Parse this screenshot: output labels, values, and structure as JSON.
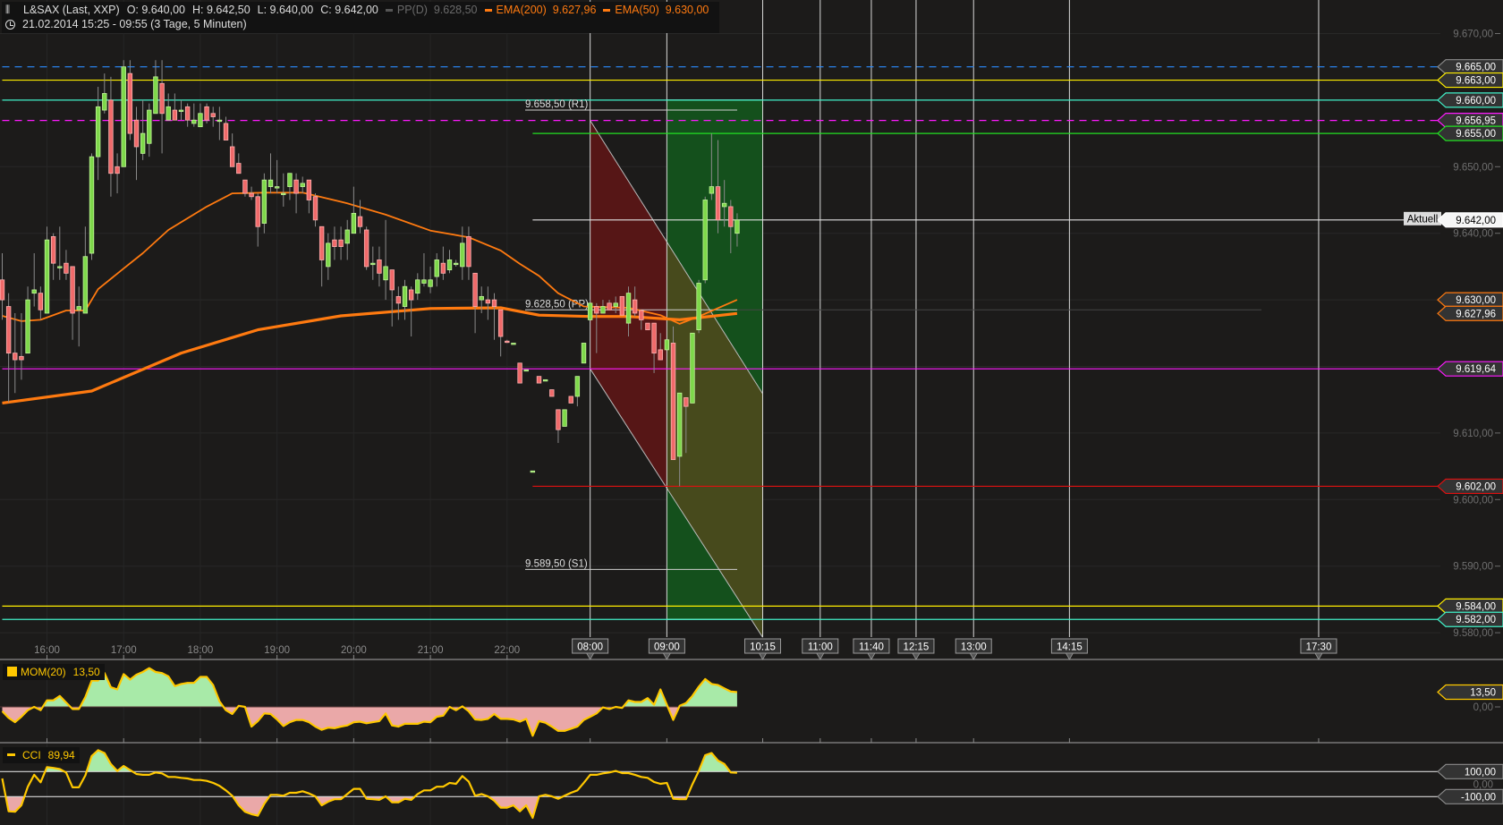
{
  "header": {
    "symbol": "L&SAX (Last, XXP)",
    "open": "O: 9.640,00",
    "high": "H: 9.642,50",
    "low": "L: 9.640,00",
    "close": "C: 9.642,00",
    "pp_label": "PP(D)",
    "pp_value": "9.628,50",
    "ema200_label": "EMA(200)",
    "ema200_value": "9.627,96",
    "ema50_label": "EMA(50)",
    "ema50_value": "9.630,00",
    "range": "21.02.2014 15:25 - 09:55 (3 Tage, 5 Minuten)",
    "icons": [
      "candlestick-chart-icon",
      "clock-icon"
    ]
  },
  "colors": {
    "background": "#1c1b1a",
    "up_candle": "#7ed84a",
    "down_candle": "#f06a6a",
    "ema": "#ff7a10",
    "indicator_line": "#ffc800",
    "positive_fill": "#a8eaa8",
    "negative_fill": "#eaa8a8"
  },
  "chart_data": {
    "type": "candlestick",
    "title": "L&SAX (Last, XXP)",
    "interval": "5 Minuten",
    "ylim": [
      9578,
      9672
    ],
    "y_ticks": [
      "9.670,00",
      "9.650,00",
      "9.640,00",
      "9.610,00",
      "9.600,00",
      "9.590,00",
      "9.580,00"
    ],
    "y_tick_values": [
      9670,
      9650,
      9640,
      9610,
      9600,
      9590,
      9580
    ],
    "grid": true,
    "x_labels": [
      {
        "i": 7,
        "label": "16:00"
      },
      {
        "i": 19,
        "label": "17:00"
      },
      {
        "i": 31,
        "label": "18:00"
      },
      {
        "i": 43,
        "label": "19:00"
      },
      {
        "i": 55,
        "label": "20:00"
      },
      {
        "i": 67,
        "label": "21:00"
      },
      {
        "i": 79,
        "label": "22:00"
      }
    ],
    "time_markers": [
      {
        "i": 92,
        "label": "08:00"
      },
      {
        "i": 104,
        "label": "09:00"
      },
      {
        "i": 119,
        "label": "10:15"
      },
      {
        "i": 128,
        "label": "11:00"
      },
      {
        "i": 136,
        "label": "11:40"
      },
      {
        "i": 143,
        "label": "12:15"
      },
      {
        "i": 152,
        "label": "13:00"
      },
      {
        "i": 167,
        "label": "14:15"
      },
      {
        "i": 206,
        "label": "17:30"
      }
    ],
    "candles": [
      [
        9633,
        9637,
        9627,
        9630
      ],
      [
        9629,
        9631,
        9614.6,
        9622
      ],
      [
        9622,
        9628,
        9616,
        9621
      ],
      [
        9621.5,
        9628,
        9618,
        9621
      ],
      [
        9622,
        9632,
        9622,
        9630
      ],
      [
        9631,
        9637,
        9629,
        9631.5
      ],
      [
        9631,
        9632,
        9627,
        9628.5
      ],
      [
        9628,
        9641,
        9628,
        9639
      ],
      [
        9639.5,
        9640,
        9633,
        9635.5
      ],
      [
        9635,
        9641,
        9633,
        9635
      ],
      [
        9635.5,
        9637.5,
        9633,
        9634
      ],
      [
        9635,
        9635,
        9624,
        9628
      ],
      [
        9628.5,
        9632,
        9623,
        9629
      ],
      [
        9628,
        9641,
        9628,
        9636.5
      ],
      [
        9637,
        9652,
        9636,
        9651.5
      ],
      [
        9651.5,
        9662,
        9648,
        9659
      ],
      [
        9658.5,
        9664,
        9658,
        9661
      ],
      [
        9660,
        9663.5,
        9645.5,
        9649
      ],
      [
        9650,
        9652,
        9646,
        9649
      ],
      [
        9650,
        9666,
        9650,
        9665
      ],
      [
        9664,
        9666,
        9654,
        9655
      ],
      [
        9657,
        9659,
        9648,
        9653
      ],
      [
        9652,
        9660,
        9651,
        9655
      ],
      [
        9653.5,
        9659.5,
        9651.5,
        9658.5
      ],
      [
        9658,
        9666,
        9658,
        9663.5
      ],
      [
        9662.5,
        9666,
        9652,
        9658
      ],
      [
        9657,
        9661,
        9657,
        9659
      ],
      [
        9658.5,
        9661,
        9657,
        9657
      ],
      [
        9658.5,
        9660,
        9657,
        9658.5
      ],
      [
        9659,
        9659.5,
        9656,
        9657
      ],
      [
        9656.5,
        9659.5,
        9656,
        9657
      ],
      [
        9656,
        9659.5,
        9656,
        9658
      ],
      [
        9659,
        9659.5,
        9656.5,
        9657
      ],
      [
        9658,
        9659,
        9656,
        9657.5
      ],
      [
        9657,
        9659,
        9654,
        9657
      ],
      [
        9656.5,
        9657.5,
        9654,
        9654
      ],
      [
        9653,
        9655,
        9650,
        9650
      ],
      [
        9650.5,
        9652,
        9649,
        9649
      ],
      [
        9648,
        9648,
        9645.5,
        9646
      ],
      [
        9646,
        9647,
        9645,
        9645.5
      ],
      [
        9645.5,
        9646,
        9638,
        9641
      ],
      [
        9641.5,
        9649,
        9640,
        9648
      ],
      [
        9647,
        9652,
        9646,
        9648
      ],
      [
        9647,
        9651,
        9646,
        9647
      ],
      [
        9646,
        9649,
        9644,
        9646
      ],
      [
        9647,
        9649,
        9645,
        9649
      ],
      [
        9648,
        9649,
        9643,
        9646
      ],
      [
        9647,
        9648.5,
        9646,
        9647.5
      ],
      [
        9648,
        9648,
        9643,
        9645
      ],
      [
        9645.5,
        9646,
        9641,
        9642
      ],
      [
        9641,
        9641,
        9632,
        9636
      ],
      [
        9635,
        9640,
        9633,
        9638.5
      ],
      [
        9639,
        9641,
        9636,
        9638
      ],
      [
        9639,
        9641,
        9636,
        9638
      ],
      [
        9638.5,
        9642,
        9636,
        9640.5
      ],
      [
        9640,
        9647,
        9640,
        9643
      ],
      [
        9642.5,
        9645,
        9640,
        9641
      ],
      [
        9640.5,
        9641,
        9634.5,
        9635
      ],
      [
        9635.5,
        9638,
        9633,
        9635.5
      ],
      [
        9636,
        9638,
        9632,
        9634
      ],
      [
        9633,
        9642,
        9630,
        9635
      ],
      [
        9634.5,
        9634.5,
        9626,
        9631.5
      ],
      [
        9630.5,
        9632,
        9627,
        9629.5
      ],
      [
        9629,
        9633,
        9627,
        9632
      ],
      [
        9631.5,
        9632,
        9624.5,
        9630
      ],
      [
        9631,
        9634,
        9630,
        9633
      ],
      [
        9632.5,
        9637,
        9632,
        9633
      ],
      [
        9632,
        9635,
        9631,
        9633
      ],
      [
        9633.5,
        9637,
        9632,
        9636
      ],
      [
        9635.5,
        9638,
        9633,
        9634
      ],
      [
        9634.5,
        9637.5,
        9634,
        9636
      ],
      [
        9635.5,
        9636,
        9635,
        9635.5
      ],
      [
        9635,
        9641,
        9633,
        9638.5
      ],
      [
        9639.5,
        9641,
        9633,
        9635
      ],
      [
        9634,
        9634,
        9625,
        9629
      ],
      [
        9630,
        9632,
        9628,
        9630.5
      ],
      [
        9630,
        9632,
        9627,
        9629.5
      ],
      [
        9630,
        9631,
        9624,
        9629
      ],
      [
        9628.5,
        9628.5,
        9621.5,
        9624.5
      ],
      [
        9623.8,
        9624,
        9623.5,
        9623.7
      ],
      [
        9623.5,
        9623.5,
        9623.5,
        9623.5
      ],
      [
        9620.5,
        9620.5,
        9617.5,
        9617.5
      ],
      [
        9619.5,
        9619.5,
        9619.5,
        9619.5
      ],
      [
        9604.3,
        9604.3,
        9604.3,
        9604.3
      ],
      [
        9618.5,
        9618.5,
        9617.5,
        9617.5
      ],
      [
        9618,
        9618,
        9618,
        9618
      ],
      [
        9616.5,
        9616.5,
        9615.5,
        9615.5
      ],
      [
        9613.5,
        9613.5,
        9608.5,
        9610.5
      ],
      [
        9611,
        9613.5,
        9611,
        9613.5
      ],
      [
        9615.5,
        9615.5,
        9614.5,
        9614.5
      ],
      [
        9615.5,
        9618.5,
        9614,
        9618.5
      ],
      [
        9620.5,
        9623.5,
        9620.5,
        9623.5
      ],
      [
        9627,
        9630,
        9627,
        9629.5
      ],
      [
        9629,
        9629.5,
        9622,
        9628
      ],
      [
        9628,
        9630,
        9628,
        9629
      ],
      [
        9629.5,
        9630,
        9628.5,
        9628.5
      ],
      [
        9629,
        9630.5,
        9628,
        9629.5
      ],
      [
        9630.5,
        9630.5,
        9627.7,
        9627.7
      ],
      [
        9626.5,
        9632,
        9624.5,
        9631
      ],
      [
        9630,
        9632,
        9627.5,
        9628
      ],
      [
        9628.4,
        9628.4,
        9625.5,
        9627
      ],
      [
        9626.5,
        9626.5,
        9625.5,
        9625.5
      ],
      [
        9626.5,
        9626.5,
        9619,
        9622
      ],
      [
        9622.5,
        9625,
        9621,
        9621
      ],
      [
        9622.5,
        9624,
        9622.5,
        9624
      ],
      [
        9623.5,
        9626,
        9606,
        9606
      ],
      [
        9606.5,
        9616,
        9602,
        9616
      ],
      [
        9615.3,
        9615.3,
        9607,
        9614
      ],
      [
        9614.5,
        9625,
        9614.5,
        9625
      ],
      [
        9625.5,
        9633,
        9625,
        9632.5
      ],
      [
        9633,
        9645.5,
        9632.5,
        9645
      ],
      [
        9646,
        9655,
        9645,
        9647
      ],
      [
        9647,
        9654,
        9640,
        9642
      ],
      [
        9644,
        9648,
        9641,
        9644.5
      ],
      [
        9644,
        9645,
        9637,
        9641
      ],
      [
        9640,
        9643,
        9638,
        9642
      ]
    ],
    "ema50": [
      [
        0,
        9627.6
      ],
      [
        3,
        9626.8
      ],
      [
        6,
        9627
      ],
      [
        10,
        9628.4
      ],
      [
        13,
        9628.4
      ],
      [
        15,
        9631.6
      ],
      [
        19,
        9634.7
      ],
      [
        22,
        9637
      ],
      [
        26,
        9640.5
      ],
      [
        32,
        9644
      ],
      [
        36,
        9646
      ],
      [
        41,
        9646.1
      ],
      [
        47,
        9646.1
      ],
      [
        54,
        9644.5
      ],
      [
        60,
        9642.8
      ],
      [
        67,
        9640.4
      ],
      [
        73,
        9639.4
      ],
      [
        78,
        9637.4
      ],
      [
        81,
        9635.4
      ],
      [
        84,
        9633.6
      ],
      [
        87,
        9631
      ],
      [
        91,
        9629
      ],
      [
        98,
        9628.8
      ],
      [
        103,
        9627.7
      ],
      [
        106,
        9626.4
      ],
      [
        109,
        9627.5
      ],
      [
        115,
        9630
      ]
    ],
    "ema200": [
      [
        0,
        9614.5
      ],
      [
        14,
        9616.3
      ],
      [
        28,
        9622
      ],
      [
        40,
        9625.5
      ],
      [
        53,
        9627.6
      ],
      [
        67,
        9628.7
      ],
      [
        78,
        9628.8
      ],
      [
        84,
        9627.7
      ],
      [
        92,
        9627.5
      ],
      [
        98,
        9627.5
      ],
      [
        106,
        9627
      ],
      [
        115,
        9627.96
      ]
    ],
    "levels": [
      {
        "value": 9665.0,
        "label": "9.665,00",
        "color": "#2a8cff",
        "style": "dashed",
        "from_i": 0,
        "badge": "#8a8a8a"
      },
      {
        "value": 9663.0,
        "label": "9.663,00",
        "color": "#ffee00",
        "style": "solid",
        "from_i": 0,
        "badge": "#ffee00"
      },
      {
        "value": 9660.0,
        "label": "9.660,00",
        "color": "#40f0c8",
        "style": "solid",
        "from_i": 0,
        "badge": "#40f0c8"
      },
      {
        "value": 9656.95,
        "label": "9.656,95",
        "color": "#ff1aff",
        "style": "dashed",
        "from_i": 0,
        "badge": "#ff1aff"
      },
      {
        "value": 9655.0,
        "label": "9.655,00",
        "color": "#22e022",
        "style": "solid",
        "from_i": 83,
        "badge": "#22e022"
      },
      {
        "value": 9642.0,
        "label": "9.642,00",
        "color": "#e0e0e0",
        "style": "solid",
        "from_i": 83,
        "badge": "current"
      },
      {
        "value": 9630.0,
        "label": "9.630,00",
        "color": "none",
        "style": "none",
        "from_i": 0,
        "badge": "#ff7a10"
      },
      {
        "value": 9627.96,
        "label": "9.627,96",
        "color": "none",
        "style": "none",
        "from_i": 0,
        "badge": "#ff7a10"
      },
      {
        "value": 9619.64,
        "label": "9.619,64",
        "color": "#ff1aff",
        "style": "solid",
        "from_i": 0,
        "badge": "#ff1aff"
      },
      {
        "value": 9602.0,
        "label": "9.602,00",
        "color": "#e01010",
        "style": "solid",
        "from_i": 83,
        "badge": "#e01010"
      },
      {
        "value": 9584.0,
        "label": "9.584,00",
        "color": "#ffee00",
        "style": "solid",
        "from_i": 0,
        "badge": "#ffee00"
      },
      {
        "value": 9582.0,
        "label": "9.582,00",
        "color": "#40f0c8",
        "style": "solid",
        "from_i": 0,
        "badge": "#40f0c8"
      }
    ],
    "current_label": "Aktuell",
    "pivots": [
      {
        "value": 9658.5,
        "label": "9.658,50 (R1)"
      },
      {
        "value": 9628.5,
        "label": "9.628,50 (PP)"
      },
      {
        "value": 9589.5,
        "label": "9.589,50 (S1)"
      }
    ],
    "drawings": {
      "rectangle": {
        "from_i": 104,
        "to_i": 119,
        "top": 9660,
        "bottom": 9582
      },
      "channel": {
        "from_i": 92,
        "to_i": 119,
        "start_top": 9656.95,
        "end_top": 9615.9,
        "start_bottom": 9619.64,
        "end_bottom": 9579.3
      }
    },
    "indicators": {
      "mom": {
        "name": "MOM(20)",
        "value": "13,50",
        "badge": "13,50",
        "zero_label": "0,00",
        "values": [
          -4,
          -10,
          -14,
          -9,
          -3,
          0,
          -3,
          6,
          6,
          10,
          4,
          -2,
          -2,
          9,
          24,
          24,
          31,
          18,
          16,
          30,
          25,
          29.5,
          32,
          35.5,
          32,
          31,
          28,
          19,
          21,
          22,
          22,
          27.5,
          27.5,
          20,
          5,
          -3,
          -6.5,
          1,
          0,
          -18,
          -13,
          -6,
          -6.5,
          -11.5,
          -17.5,
          -14,
          -12,
          -12,
          -14,
          -18,
          -21,
          -19,
          -19.5,
          -18,
          -17,
          -14,
          -13.5,
          -15,
          -14,
          -13,
          -6,
          -17,
          -18,
          -15.5,
          -15.5,
          -15.5,
          -13.5,
          -14,
          -9,
          -8,
          0,
          -3,
          0.5,
          -4,
          -11.5,
          -12,
          -11,
          -6.5,
          -11,
          -11,
          -11.5,
          -13.5,
          -11,
          -26.5,
          -13,
          -14.5,
          -18,
          -22,
          -22,
          -20,
          -18,
          -12,
          -9,
          -6,
          -0.5,
          -2,
          0,
          -1,
          6,
          4.5,
          4.5,
          8,
          2,
          16,
          2,
          -12,
          1,
          3.5,
          10,
          18.5,
          25.5,
          21,
          20,
          17,
          14,
          13.5
        ]
      },
      "cci": {
        "name": "CCI",
        "value": "89,94",
        "upper_label": "100,00",
        "zero_label": "0,00",
        "lower_label": "-100,00",
        "upper": 100,
        "lower": -100,
        "values": [
          45,
          -217,
          -221,
          -169,
          -21,
          74,
          14,
          136,
          129,
          120,
          93,
          -26,
          -26,
          69,
          224,
          271,
          248,
          160,
          105,
          145,
          112,
          81,
          74,
          74,
          93,
          86,
          57,
          57,
          50,
          45,
          33,
          33,
          26,
          10,
          -14,
          -50,
          -93,
          -169,
          -221,
          -240,
          -252,
          -157,
          -86,
          -86,
          -93,
          -69,
          -69,
          -57,
          -74,
          -98,
          -169,
          -140,
          -121,
          -121,
          -79,
          -38,
          -38,
          -117,
          -121,
          -126,
          -98,
          -145,
          -145,
          -117,
          -126,
          -79,
          -50,
          -50,
          -21,
          -21,
          10,
          2,
          64,
          21,
          -93,
          -79,
          -98,
          -133,
          -188,
          -188,
          -169,
          -217,
          -169,
          -269,
          -98,
          -86,
          -98,
          -117,
          -93,
          -69,
          -50,
          10,
          74,
          74,
          86,
          93,
          105,
          88,
          88,
          74,
          57,
          50,
          17,
          2,
          10,
          -117,
          -121,
          -121,
          -2,
          105,
          231,
          248,
          188,
          160,
          93,
          89.94
        ]
      }
    }
  }
}
